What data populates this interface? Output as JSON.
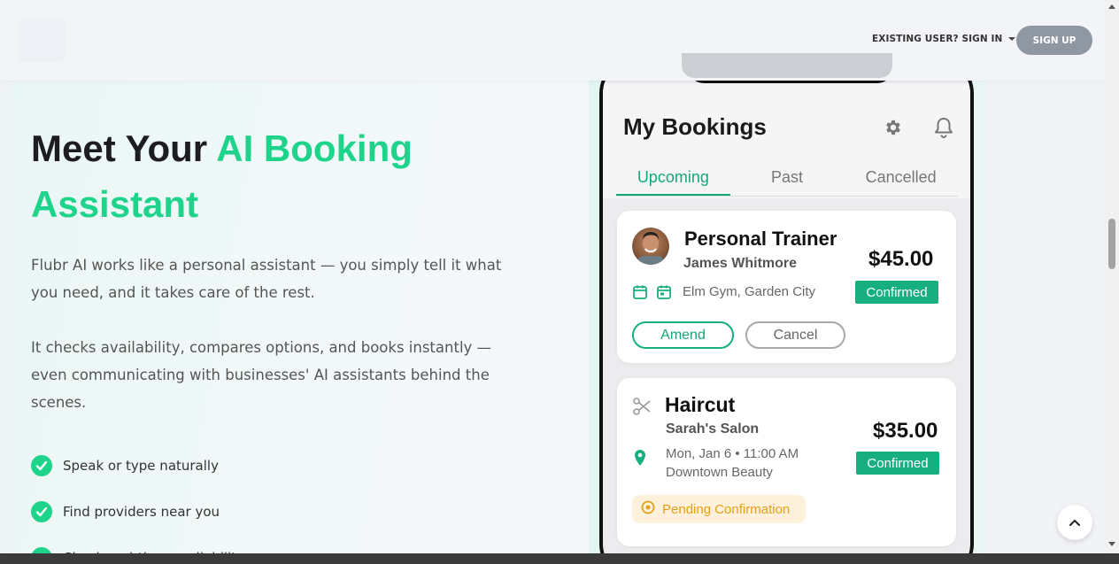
{
  "header": {
    "signin_label": "EXISTING USER? SIGN IN",
    "signup_label": "SIGN UP"
  },
  "hero": {
    "title_part1": "Meet Your ",
    "title_part2": "AI Booking Assistant",
    "paragraph1": "Flubr AI works like a personal assistant — you simply tell it what you need, and it takes care of the rest.",
    "paragraph2": "It checks availability, compares options, and books instantly — even communicating with businesses' AI assistants behind the scenes.",
    "features": [
      "Speak or type naturally",
      "Find providers near you",
      "Check real-time availability"
    ]
  },
  "app": {
    "title": "My Bookings",
    "tabs": [
      "Upcoming",
      "Past",
      "Cancelled"
    ],
    "active_tab": "Upcoming",
    "bookings": [
      {
        "service": "Personal Trainer",
        "provider": "James Whitmore",
        "location": "Elm Gym, Garden City",
        "price": "$45.00",
        "status": "Confirmed",
        "amend_label": "Amend",
        "cancel_label": "Cancel"
      },
      {
        "service": "Haircut",
        "provider": "Sarah's Salon",
        "datetime": "Mon, Jan 6 • 11:00 AM",
        "venue": "Downtown Beauty",
        "price": "$35.00",
        "status": "Confirmed",
        "pending_label": "Pending Confirmation"
      }
    ]
  },
  "colors": {
    "accent_green": "#1ed48a",
    "app_green": "#17ae80",
    "pending_orange": "#e3a01a",
    "signup_button": "#8e97a2"
  }
}
